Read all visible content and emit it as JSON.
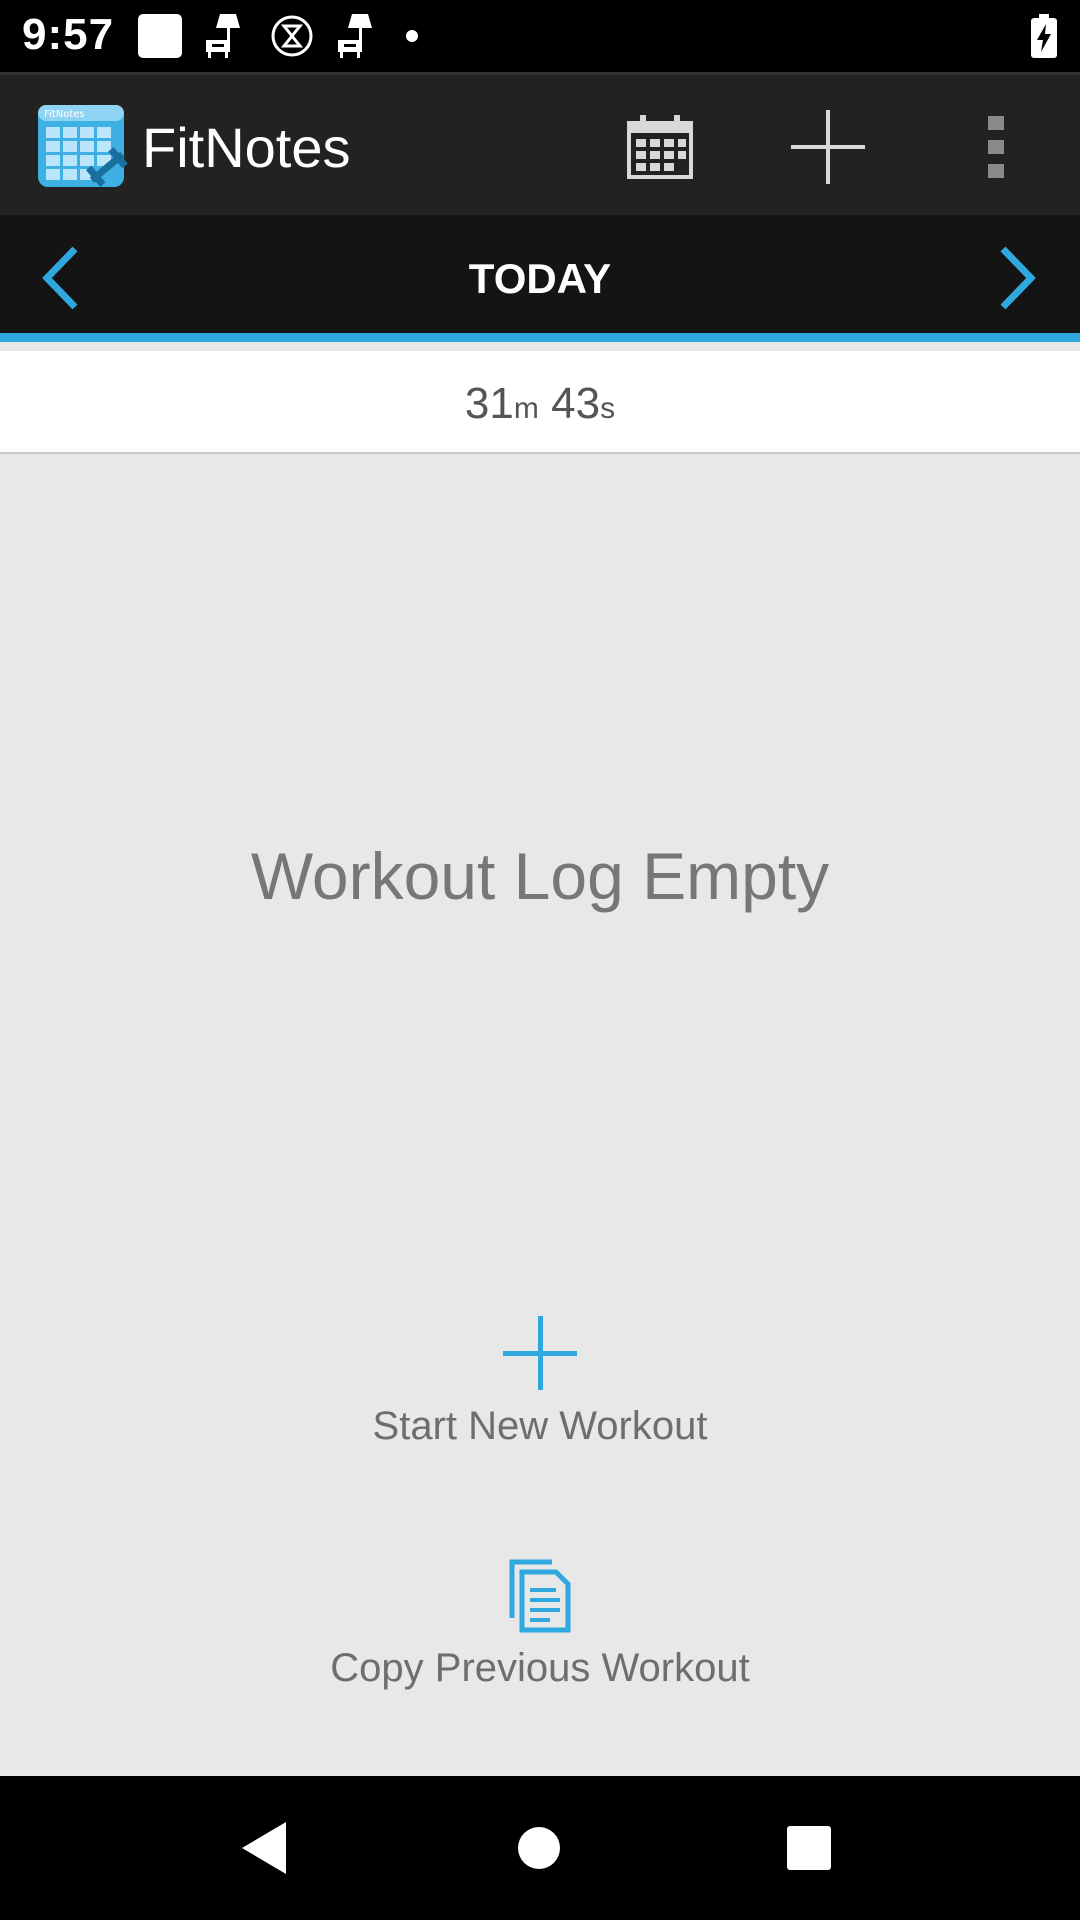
{
  "status_bar": {
    "time": "9:57",
    "icons": [
      "notification-square-icon",
      "lamp-icon",
      "hourglass-icon",
      "lamp-icon",
      "dot-icon"
    ],
    "battery": "battery-charging-icon"
  },
  "app_bar": {
    "title": "FitNotes",
    "actions": [
      "calendar-icon",
      "add-icon",
      "overflow-menu-icon"
    ]
  },
  "date_nav": {
    "label": "TODAY"
  },
  "timer": {
    "minutes": "31",
    "minutes_unit": "m",
    "seconds": "43",
    "seconds_unit": "s"
  },
  "main": {
    "empty_message": "Workout Log Empty",
    "start_label": "Start New Workout",
    "copy_label": "Copy Previous Workout"
  },
  "colors": {
    "accent": "#2ea8de",
    "app_bar": "#222222",
    "date_bar": "#141414",
    "background": "#e8e8e8"
  }
}
